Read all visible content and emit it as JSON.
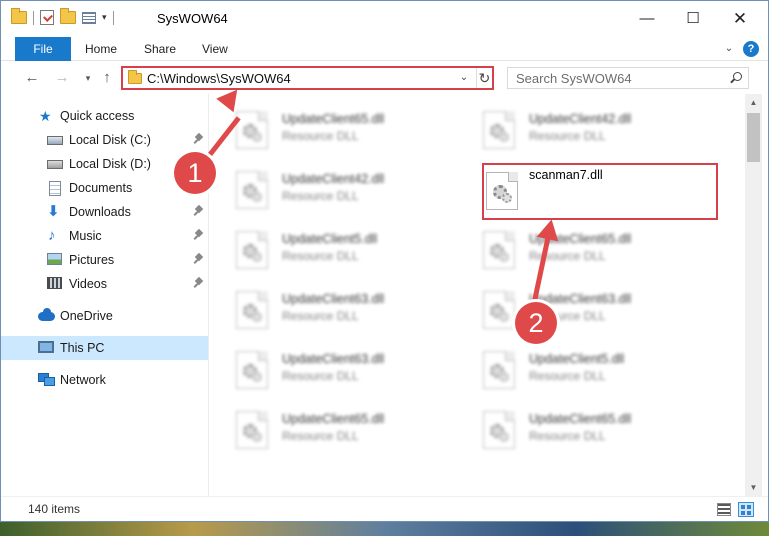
{
  "window": {
    "title": "SysWOW64",
    "min_label": "—",
    "max_label": "☐",
    "close_label": "✕"
  },
  "ribbon": {
    "tabs": [
      "File",
      "Home",
      "Share",
      "View"
    ],
    "help": "?"
  },
  "address": {
    "path": "C:\\Windows\\SysWOW64"
  },
  "search": {
    "placeholder": "Search SysWOW64"
  },
  "sidebar": {
    "items": [
      {
        "label": "Quick access",
        "icon": "star-icon",
        "pinned": false
      },
      {
        "label": "Local Disk (C:)",
        "icon": "drive-icon",
        "pinned": true
      },
      {
        "label": "Local Disk (D:)",
        "icon": "drive-icon",
        "pinned": false
      },
      {
        "label": "Documents",
        "icon": "documents-icon",
        "pinned": true
      },
      {
        "label": "Downloads",
        "icon": "download-icon",
        "pinned": true
      },
      {
        "label": "Music",
        "icon": "music-icon",
        "pinned": true
      },
      {
        "label": "Pictures",
        "icon": "pictures-icon",
        "pinned": true
      },
      {
        "label": "Videos",
        "icon": "videos-icon",
        "pinned": true
      },
      {
        "label": "OneDrive",
        "icon": "onedrive-icon",
        "pinned": false
      },
      {
        "label": "This PC",
        "icon": "pc-icon",
        "pinned": false,
        "selected": true
      },
      {
        "label": "Network",
        "icon": "network-icon",
        "pinned": false
      }
    ]
  },
  "files": {
    "left_column": [
      {
        "name": "UpdateClient65.dll",
        "type": "Resource DLL"
      },
      {
        "name": "UpdateClient42.dll",
        "type": "Resource DLL"
      },
      {
        "name": "UpdateClient5.dll",
        "type": "Resource DLL"
      },
      {
        "name": "UpdateClient63.dll",
        "type": "Resource DLL"
      },
      {
        "name": "UpdateClient63.dll",
        "type": "Resource DLL"
      },
      {
        "name": "UpdateClient65.dll",
        "type": "Resource DLL"
      }
    ],
    "right_column": [
      {
        "name": "UpdateClient42.dll",
        "type": "Resource DLL"
      },
      {
        "name": "scanman7.dll",
        "type": ""
      },
      {
        "name": "UpdateClient65.dll",
        "type": "Resource DLL"
      },
      {
        "name": "UpdateClient63.dll",
        "type": "Resource DLL"
      },
      {
        "name": "UpdateClient5.dll",
        "type": "Resource DLL"
      },
      {
        "name": "UpdateClient65.dll",
        "type": "Resource DLL"
      }
    ]
  },
  "status": {
    "item_count": "140 items"
  },
  "annotations": {
    "step1": "1",
    "step2": "2",
    "color": "#e0494a"
  },
  "colors": {
    "accent": "#1979ca",
    "selection": "#cce8ff",
    "highlight": "#d6404a"
  }
}
